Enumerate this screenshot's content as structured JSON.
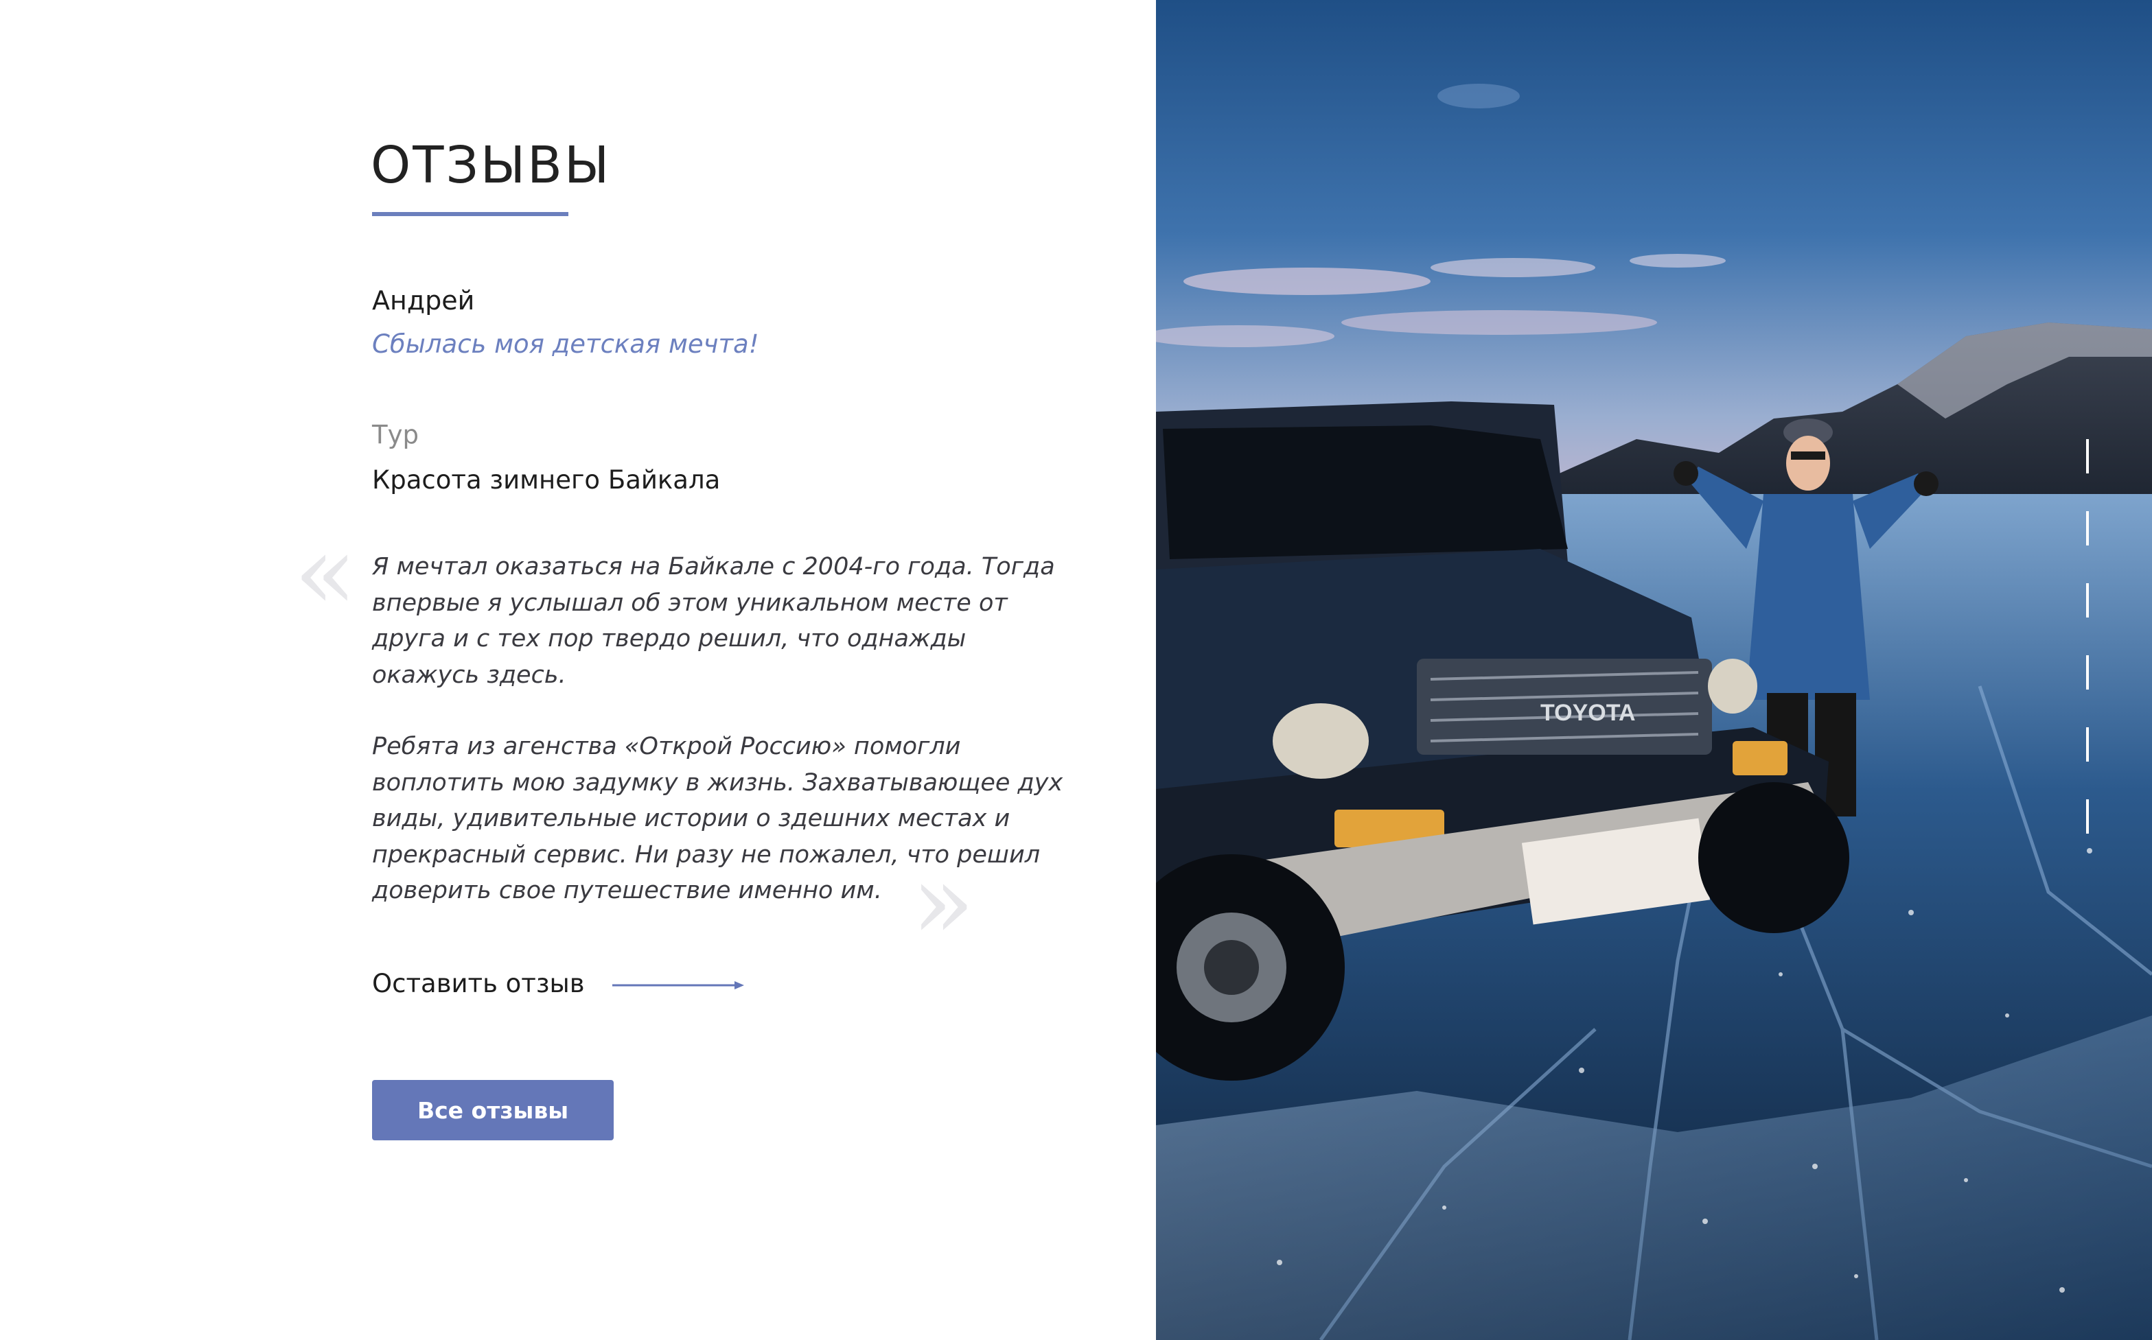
{
  "section": {
    "title": "ОТЗЫВЫ"
  },
  "testimonial": {
    "author": "Андрей",
    "headline": "Сбылась моя детская мечта!",
    "tour_label": "Тур",
    "tour_name": "Красота зимнего Байкала",
    "quote_open": "«",
    "quote_close": "»",
    "paragraphs": [
      "Я мечтал оказаться на Байкале с 2004-го года. Тогда впервые я услышал об этом уникальном месте от друга и с тех пор твердо решил, что однажды окажусь здесь.",
      "Ребята из агенства «Открой Россию» помогли воплотить мою задумку в жизнь. Захватывающее дух виды, удивительные истории о здешних местах и прекрасный сервис. Ни разу не пожалел, что решил доверить свое путешествие именно им."
    ]
  },
  "actions": {
    "leave_review": "Оставить отзыв",
    "all_reviews": "Все отзывы"
  },
  "photo": {
    "vehicle_badge": "TOYOTA"
  },
  "colors": {
    "accent": "#6477b8",
    "headline": "#6c80bf",
    "quote_marks": "#e7e7ea"
  },
  "icons": {
    "leave_review_arrow": "arrow-right-icon"
  }
}
